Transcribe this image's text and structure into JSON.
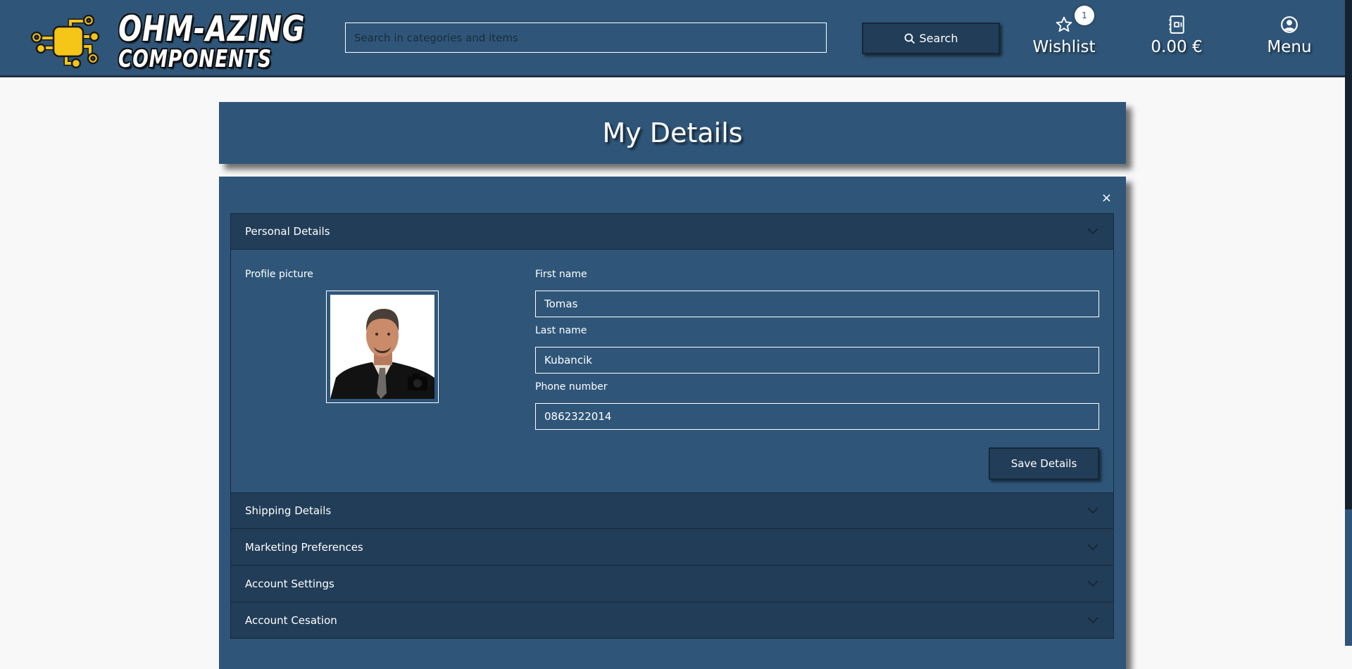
{
  "brand": {
    "line1": "OHM-AZING",
    "line2": "COMPONENTS",
    "accent": "#f5c518"
  },
  "header": {
    "search_placeholder": "Search in categories and items",
    "search_value": "",
    "search_button": "Search",
    "wishlist_label": "Wishlist",
    "wishlist_count": "1",
    "cart_total": "0.00 €",
    "menu_label": "Menu"
  },
  "page": {
    "title": "My Details",
    "close_symbol": "×"
  },
  "accordion": {
    "sections": [
      {
        "label": "Personal Details",
        "expanded": true
      },
      {
        "label": "Shipping Details",
        "expanded": false
      },
      {
        "label": "Marketing Preferences",
        "expanded": false
      },
      {
        "label": "Account Settings",
        "expanded": false
      },
      {
        "label": "Account Cesation",
        "expanded": false
      }
    ]
  },
  "personal": {
    "profile_picture_label": "Profile picture",
    "first_name_label": "First name",
    "first_name": "Tomas",
    "last_name_label": "Last name",
    "last_name": "Kubancik",
    "phone_label": "Phone number",
    "phone": "0862322014",
    "save_button": "Save Details"
  },
  "colors": {
    "primary": "#2f5679",
    "dark": "#223d57",
    "border": "#16293b",
    "background": "#f8f8f8"
  }
}
